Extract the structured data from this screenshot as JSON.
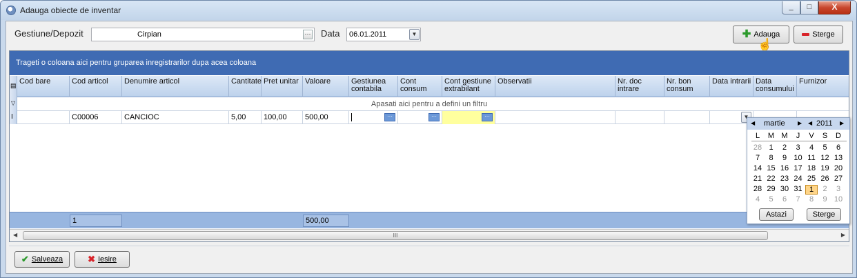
{
  "window": {
    "title": "Adauga obiecte de inventar",
    "min": "_",
    "max": "□",
    "close": "X"
  },
  "toolbar": {
    "gestiune_label": "Gestiune/Depozit",
    "gestiune_value": "Cirpian",
    "data_label": "Data",
    "data_value": "06.01.2011",
    "add_label": "Adauga",
    "delete_label": "Sterge"
  },
  "grid": {
    "group_hint": "Trageti o coloana aici pentru gruparea inregistrarilor dupa acea coloana",
    "filter_hint": "Apasati aici pentru a defini un filtru",
    "columns": [
      {
        "label": "Cod bare"
      },
      {
        "label": "Cod articol"
      },
      {
        "label": "Denumire articol"
      },
      {
        "label": "Cantitate"
      },
      {
        "label": "Pret unitar"
      },
      {
        "label": "Valoare"
      },
      {
        "label": "Gestiunea contabila"
      },
      {
        "label": "Cont consum"
      },
      {
        "label": "Cont gestiune extrabilant"
      },
      {
        "label": "Observatii"
      },
      {
        "label": "Nr. doc intrare"
      },
      {
        "label": "Nr. bon consum"
      },
      {
        "label": "Data intrarii"
      },
      {
        "label": "Data consumului"
      },
      {
        "label": "Furnizor"
      }
    ],
    "row": {
      "cod_articol": "C00006",
      "denumire": "CANCIOC",
      "cantitate": "5,00",
      "pret": "100,00",
      "valoare": "500,00"
    },
    "footer": {
      "count": "1",
      "total": "500,00"
    },
    "scroll_grip": "III"
  },
  "calendar": {
    "month": "martie",
    "year": "2011",
    "weekdays": [
      "L",
      "M",
      "M",
      "J",
      "V",
      "S",
      "D"
    ],
    "weeks": [
      [
        "28",
        "1",
        "2",
        "3",
        "4",
        "5",
        "6"
      ],
      [
        "7",
        "8",
        "9",
        "10",
        "11",
        "12",
        "13"
      ],
      [
        "14",
        "15",
        "16",
        "17",
        "18",
        "19",
        "20"
      ],
      [
        "21",
        "22",
        "23",
        "24",
        "25",
        "26",
        "27"
      ],
      [
        "28",
        "29",
        "30",
        "31",
        "1",
        "2",
        "3"
      ],
      [
        "4",
        "5",
        "6",
        "7",
        "8",
        "9",
        "10"
      ]
    ],
    "today_label": "Astazi",
    "clear_label": "Sterge"
  },
  "actions": {
    "save_label": "Salveaza",
    "exit_label": "Iesire"
  },
  "colors": {
    "group_panel": "#3f6bb3",
    "highlight_cell": "#ffff9e",
    "selected_day": "#ffd588"
  }
}
